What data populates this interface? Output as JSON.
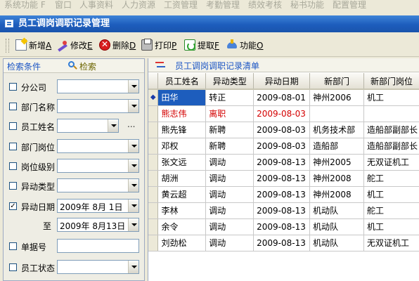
{
  "menubar": [
    "系统功能 F",
    "窗口",
    "人事资料",
    "人力资源",
    "工资管理",
    "考勤管理",
    "绩效考核",
    "秘书功能",
    "配置管理"
  ],
  "window": {
    "title": "员工调岗调职记录管理"
  },
  "toolbar": [
    {
      "key": "A",
      "label": "新增",
      "icon": "new-document-icon"
    },
    {
      "key": "E",
      "label": "修改",
      "icon": "edit-pencil-icon"
    },
    {
      "key": "D",
      "label": "删除",
      "icon": "delete-x-icon"
    },
    {
      "key": "P",
      "label": "打印",
      "icon": "printer-icon"
    },
    {
      "key": "F",
      "label": "提取",
      "icon": "extract-refresh-icon"
    },
    {
      "key": "O",
      "label": "功能",
      "icon": "function-icon"
    }
  ],
  "filter": {
    "header": "检索条件",
    "search_label": "检索",
    "rows": [
      {
        "label": "分公司",
        "checked": false,
        "value": ""
      },
      {
        "label": "部门名称",
        "checked": false,
        "value": ""
      },
      {
        "label": "员工姓名",
        "checked": false,
        "value": "",
        "extra": "..."
      },
      {
        "label": "部门岗位",
        "checked": false,
        "value": ""
      },
      {
        "label": "岗位级别",
        "checked": false,
        "value": ""
      },
      {
        "label": "异动类型",
        "checked": false,
        "value": ""
      },
      {
        "label": "异动日期",
        "checked": true,
        "value": "2009年  8月  1日"
      },
      {
        "label": "至",
        "value": "2009年  8月13日"
      },
      {
        "label": "单据号",
        "checked": false,
        "value": ""
      },
      {
        "label": "员工状态",
        "checked": false,
        "value": ""
      }
    ]
  },
  "list": {
    "title": "员工调岗调职记录清单",
    "columns": [
      "",
      "员工姓名",
      "异动类型",
      "异动日期",
      "新部门",
      "新部门岗位"
    ],
    "rows": [
      {
        "indicator": "◆",
        "name": "田华",
        "type": "转正",
        "date": "2009-08-01",
        "dept": "神州2006",
        "post": "机工",
        "selected": true
      },
      {
        "indicator": "",
        "name": "熊志伟",
        "type": "离职",
        "date": "2009-08-03",
        "dept": "",
        "post": "",
        "highlight": "#d40000"
      },
      {
        "indicator": "",
        "name": "熊先锋",
        "type": "新聘",
        "date": "2009-08-03",
        "dept": "机务技术部",
        "post": "造船部副部长"
      },
      {
        "indicator": "",
        "name": "邓权",
        "type": "新聘",
        "date": "2009-08-03",
        "dept": "造船部",
        "post": "造船部副部长"
      },
      {
        "indicator": "",
        "name": "张文远",
        "type": "调动",
        "date": "2009-08-13",
        "dept": "神州2005",
        "post": "无双证机工"
      },
      {
        "indicator": "",
        "name": "胡洲",
        "type": "调动",
        "date": "2009-08-13",
        "dept": "神州2008",
        "post": "舵工"
      },
      {
        "indicator": "",
        "name": "黄云超",
        "type": "调动",
        "date": "2009-08-13",
        "dept": "神州2008",
        "post": "机工"
      },
      {
        "indicator": "",
        "name": "李林",
        "type": "调动",
        "date": "2009-08-13",
        "dept": "机动队",
        "post": "舵工"
      },
      {
        "indicator": "",
        "name": "余令",
        "type": "调动",
        "date": "2009-08-13",
        "dept": "机动队",
        "post": "机工"
      },
      {
        "indicator": "",
        "name": "刘劲松",
        "type": "调动",
        "date": "2009-08-13",
        "dept": "机动队",
        "post": "无双证机工"
      }
    ]
  }
}
